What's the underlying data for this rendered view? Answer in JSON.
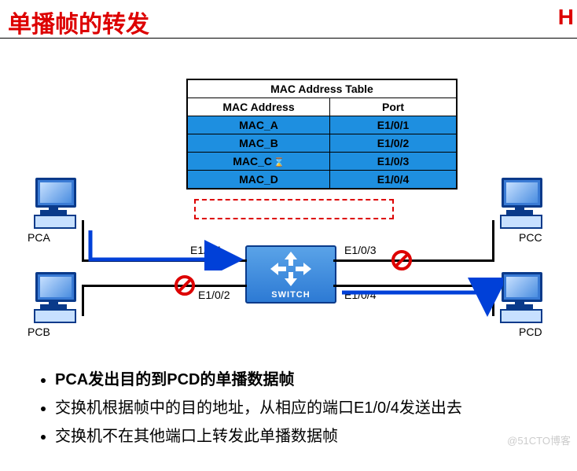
{
  "title": "单播帧的转发",
  "logo": "H",
  "table": {
    "caption": "MAC Address Table",
    "col1": "MAC Address",
    "col2": "Port",
    "rows": [
      {
        "mac": "MAC_A",
        "port": "E1/0/1"
      },
      {
        "mac": "MAC_B",
        "port": "E1/0/2"
      },
      {
        "mac": "MAC_C",
        "port": "E1/0/3"
      },
      {
        "mac": "MAC_D",
        "port": "E1/0/4"
      }
    ]
  },
  "pcs": {
    "a": "PCA",
    "b": "PCB",
    "c": "PCC",
    "d": "PCD"
  },
  "ports": {
    "p1": "E1/0/1",
    "p2": "E1/0/2",
    "p3": "E1/0/3",
    "p4": "E1/0/4"
  },
  "switch_label": "SWITCH",
  "bullets": [
    "PCA发出目的到PCD的单播数据帧",
    "交换机根据帧中的目的地址，从相应的端口E1/0/4发送出去",
    "交换机不在其他端口上转发此单播数据帧"
  ],
  "watermark": "@51CTO博客",
  "hourglass": "⌛"
}
